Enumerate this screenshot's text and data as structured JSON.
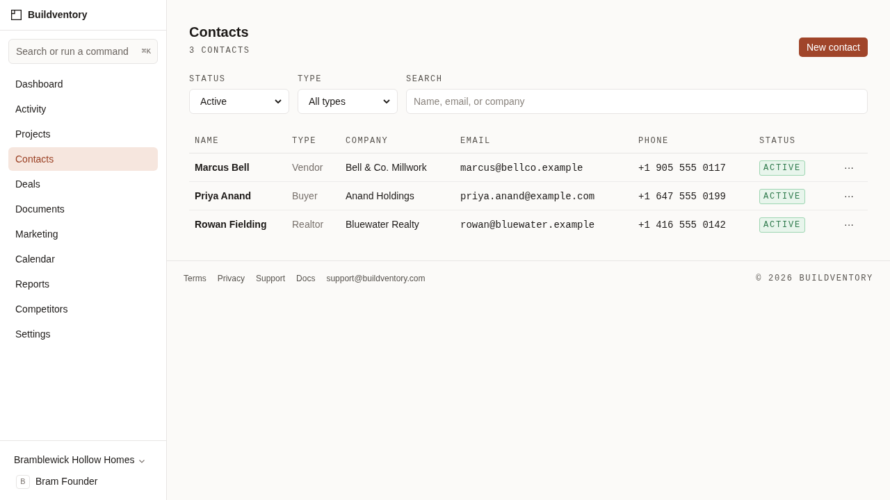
{
  "app": {
    "name": "Buildventory"
  },
  "sidebar": {
    "search": {
      "placeholder": "Search or run a command",
      "shortcut": "⌘K"
    },
    "items": [
      {
        "label": "Dashboard",
        "selected": false
      },
      {
        "label": "Activity",
        "selected": false
      },
      {
        "label": "Projects",
        "selected": false
      },
      {
        "label": "Contacts",
        "selected": true
      },
      {
        "label": "Deals",
        "selected": false
      },
      {
        "label": "Documents",
        "selected": false
      },
      {
        "label": "Marketing",
        "selected": false
      },
      {
        "label": "Calendar",
        "selected": false
      },
      {
        "label": "Reports",
        "selected": false
      },
      {
        "label": "Competitors",
        "selected": false
      },
      {
        "label": "Settings",
        "selected": false
      }
    ],
    "workspace": {
      "name": "Bramblewick Hollow Homes"
    },
    "user": {
      "initial": "B",
      "name": "Bram Founder"
    }
  },
  "page": {
    "title": "Contacts",
    "count": "3 CONTACTS",
    "new_button": "New contact"
  },
  "filters": [
    {
      "kind": "select",
      "label": "STATUS",
      "value": "Active"
    },
    {
      "kind": "select",
      "label": "TYPE",
      "value": "All types"
    },
    {
      "kind": "search",
      "label": "SEARCH",
      "placeholder": "Name, email, or company"
    }
  ],
  "table": {
    "columns": [
      "NAME",
      "TYPE",
      "COMPANY",
      "EMAIL",
      "PHONE",
      "STATUS"
    ],
    "rows": [
      {
        "name": "Marcus Bell",
        "type": "Vendor",
        "company": "Bell & Co. Millwork",
        "email": "marcus@bellco.example",
        "phone": "+1 905 555 0117",
        "status": "ACTIVE",
        "actions": "···"
      },
      {
        "name": "Priya Anand",
        "type": "Buyer",
        "company": "Anand Holdings",
        "email": "priya.anand@example.com",
        "phone": "+1 647 555 0199",
        "status": "ACTIVE",
        "actions": "···"
      },
      {
        "name": "Rowan Fielding",
        "type": "Realtor",
        "company": "Bluewater Realty",
        "email": "rowan@bluewater.example",
        "phone": "+1 416 555 0142",
        "status": "ACTIVE",
        "actions": "···"
      }
    ]
  },
  "footer": {
    "links": [
      "Terms",
      "Privacy",
      "Support",
      "Docs",
      "support@buildventory.com"
    ],
    "copyright": "© 2026 BUILDVENTORY"
  }
}
